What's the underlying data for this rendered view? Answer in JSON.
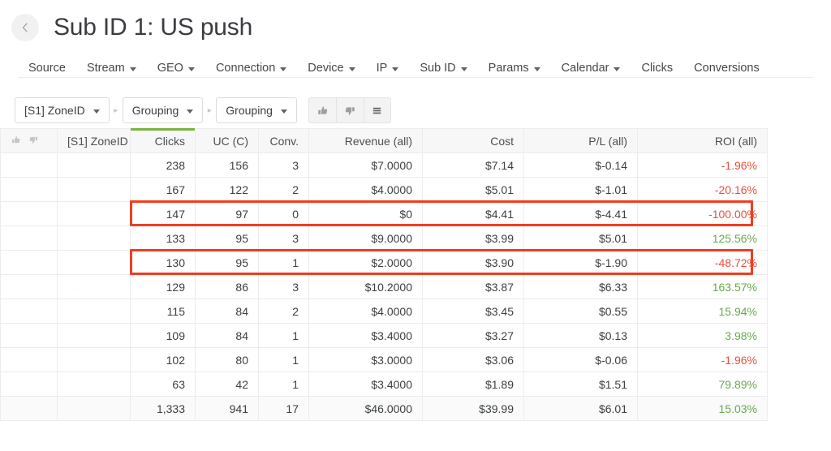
{
  "header": {
    "back_icon": "chevron-left-icon",
    "title": "Sub ID 1: US push"
  },
  "nav": {
    "items": [
      {
        "label": "Source",
        "has_caret": false
      },
      {
        "label": "Stream",
        "has_caret": true
      },
      {
        "label": "GEO",
        "has_caret": true
      },
      {
        "label": "Connection",
        "has_caret": true
      },
      {
        "label": "Device",
        "has_caret": true
      },
      {
        "label": "IP",
        "has_caret": true
      },
      {
        "label": "Sub ID",
        "has_caret": true
      },
      {
        "label": "Params",
        "has_caret": true
      },
      {
        "label": "Calendar",
        "has_caret": true
      },
      {
        "label": "Clicks",
        "has_caret": false
      },
      {
        "label": "Conversions",
        "has_caret": false
      }
    ]
  },
  "toolbar": {
    "selects": [
      {
        "label": "[S1] ZoneID"
      },
      {
        "label": "Grouping"
      },
      {
        "label": "Grouping"
      }
    ],
    "separator": "▸",
    "icons": [
      {
        "name": "thumbs-up-icon",
        "glyph": "thumb-up"
      },
      {
        "name": "thumbs-down-icon",
        "glyph": "thumb-down"
      },
      {
        "name": "menu-icon",
        "glyph": "hamburger"
      }
    ]
  },
  "table": {
    "columns": [
      {
        "key": "vote",
        "label": "",
        "align": "left",
        "sorted": false
      },
      {
        "key": "zone",
        "label": "[S1] ZoneID",
        "align": "left",
        "sorted": false
      },
      {
        "key": "clicks",
        "label": "Clicks",
        "align": "right",
        "sorted": true
      },
      {
        "key": "uc",
        "label": "UC (C)",
        "align": "right",
        "sorted": false
      },
      {
        "key": "conv",
        "label": "Conv.",
        "align": "right",
        "sorted": false
      },
      {
        "key": "rev",
        "label": "Revenue (all)",
        "align": "right",
        "sorted": false
      },
      {
        "key": "cost",
        "label": "Cost",
        "align": "right",
        "sorted": false
      },
      {
        "key": "pl",
        "label": "P/L (all)",
        "align": "right",
        "sorted": false
      },
      {
        "key": "roi",
        "label": "ROI (all)",
        "align": "right",
        "sorted": false
      }
    ],
    "rows": [
      {
        "zone": "",
        "clicks": "238",
        "uc": "156",
        "conv": "3",
        "rev": "$7.0000",
        "cost": "$7.14",
        "pl": "$-0.14",
        "roi": "-1.96%",
        "roi_sign": "neg",
        "highlight": false
      },
      {
        "zone": "",
        "clicks": "167",
        "uc": "122",
        "conv": "2",
        "rev": "$4.0000",
        "cost": "$5.01",
        "pl": "$-1.01",
        "roi": "-20.16%",
        "roi_sign": "neg",
        "highlight": false
      },
      {
        "zone": "",
        "clicks": "147",
        "uc": "97",
        "conv": "0",
        "rev": "$0",
        "cost": "$4.41",
        "pl": "$-4.41",
        "roi": "-100.00%",
        "roi_sign": "neg",
        "highlight": true
      },
      {
        "zone": "·",
        "clicks": "133",
        "uc": "95",
        "conv": "3",
        "rev": "$9.0000",
        "cost": "$3.99",
        "pl": "$5.01",
        "roi": "125.56%",
        "roi_sign": "pos",
        "highlight": false
      },
      {
        "zone": "",
        "clicks": "130",
        "uc": "95",
        "conv": "1",
        "rev": "$2.0000",
        "cost": "$3.90",
        "pl": "$-1.90",
        "roi": "-48.72%",
        "roi_sign": "neg",
        "highlight": true
      },
      {
        "zone": "···",
        "clicks": "129",
        "uc": "86",
        "conv": "3",
        "rev": "$10.2000",
        "cost": "$3.87",
        "pl": "$6.33",
        "roi": "163.57%",
        "roi_sign": "pos",
        "highlight": false
      },
      {
        "zone": "",
        "clicks": "115",
        "uc": "84",
        "conv": "2",
        "rev": "$4.0000",
        "cost": "$3.45",
        "pl": "$0.55",
        "roi": "15.94%",
        "roi_sign": "pos",
        "highlight": false
      },
      {
        "zone": "",
        "clicks": "109",
        "uc": "84",
        "conv": "1",
        "rev": "$3.4000",
        "cost": "$3.27",
        "pl": "$0.13",
        "roi": "3.98%",
        "roi_sign": "pos",
        "highlight": false
      },
      {
        "zone": "",
        "clicks": "102",
        "uc": "80",
        "conv": "1",
        "rev": "$3.0000",
        "cost": "$3.06",
        "pl": "$-0.06",
        "roi": "-1.96%",
        "roi_sign": "neg",
        "highlight": false
      },
      {
        "zone": "",
        "clicks": "63",
        "uc": "42",
        "conv": "1",
        "rev": "$3.4000",
        "cost": "$1.89",
        "pl": "$1.51",
        "roi": "79.89%",
        "roi_sign": "pos",
        "highlight": false
      }
    ],
    "total": {
      "zone": "",
      "clicks": "1,333",
      "uc": "941",
      "conv": "17",
      "rev": "$46.0000",
      "cost": "$39.99",
      "pl": "$6.01",
      "roi": "15.03%",
      "roi_sign": "pos"
    }
  },
  "colors": {
    "positive": "#6aa84f",
    "negative": "#e8503a",
    "highlight_border": "#ef3e22",
    "sort_indicator": "#7cb342"
  }
}
